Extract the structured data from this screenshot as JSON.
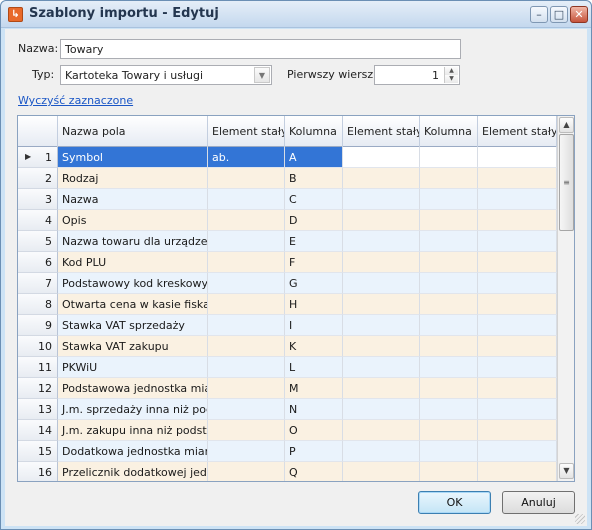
{
  "window": {
    "title": "Szablony importu - Edytuj",
    "minimize": "–",
    "maximize": "□",
    "close": "✕",
    "app_icon": "import-arrow-icon"
  },
  "form": {
    "name_label": "Nazwa:",
    "name_value": "Towary",
    "type_label": "Typ:",
    "type_value": "Kartoteka Towary i usługi",
    "first_row_label": "Pierwszy wiersz:",
    "first_row_value": "1",
    "clear_link": "Wyczyść zaznaczone"
  },
  "grid": {
    "columns": [
      "Nazwa pola",
      "Element stały",
      "Kolumna",
      "Element stały",
      "Kolumna",
      "Element stały"
    ],
    "selected_row": 0,
    "rows": [
      {
        "num": "1",
        "field": "Symbol",
        "const1": "ab.",
        "col1": "A"
      },
      {
        "num": "2",
        "field": "Rodzaj",
        "const1": "",
        "col1": "B"
      },
      {
        "num": "3",
        "field": "Nazwa",
        "const1": "",
        "col1": "C"
      },
      {
        "num": "4",
        "field": "Opis",
        "const1": "",
        "col1": "D"
      },
      {
        "num": "5",
        "field": "Nazwa towaru dla urządzeń",
        "const1": "",
        "col1": "E"
      },
      {
        "num": "6",
        "field": "Kod PLU",
        "const1": "",
        "col1": "F"
      },
      {
        "num": "7",
        "field": "Podstawowy kod kreskowy",
        "const1": "",
        "col1": "G"
      },
      {
        "num": "8",
        "field": "Otwarta cena w kasie fiskalnej",
        "const1": "",
        "col1": "H"
      },
      {
        "num": "9",
        "field": "Stawka VAT sprzedaży",
        "const1": "",
        "col1": "I"
      },
      {
        "num": "10",
        "field": "Stawka VAT zakupu",
        "const1": "",
        "col1": "K"
      },
      {
        "num": "11",
        "field": "PKWiU",
        "const1": "",
        "col1": "L"
      },
      {
        "num": "12",
        "field": "Podstawowa jednostka miary",
        "const1": "",
        "col1": "M"
      },
      {
        "num": "13",
        "field": "J.m. sprzedaży inna niż podst.",
        "const1": "",
        "col1": "N"
      },
      {
        "num": "14",
        "field": "J.m. zakupu inna niż podst.",
        "const1": "",
        "col1": "O"
      },
      {
        "num": "15",
        "field": "Dodatkowa jednostka miary",
        "const1": "",
        "col1": "P"
      },
      {
        "num": "16",
        "field": "Przelicznik dodatkowej jedn.",
        "const1": "",
        "col1": "Q"
      }
    ]
  },
  "buttons": {
    "ok": "OK",
    "cancel": "Anuluj"
  },
  "colors": {
    "row_odd": "#eaf3fc",
    "row_even": "#faf1e2",
    "selected": "#3375d6",
    "link": "#1a56c6"
  }
}
